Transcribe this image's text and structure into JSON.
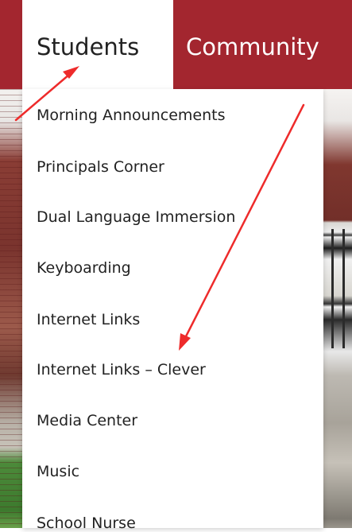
{
  "nav": {
    "students_label": "Students",
    "community_label": "Community",
    "accent_color": "#a3262f"
  },
  "dropdown": {
    "items": [
      {
        "label": "Morning Announcements"
      },
      {
        "label": "Principals Corner"
      },
      {
        "label": "Dual Language Immersion"
      },
      {
        "label": "Keyboarding"
      },
      {
        "label": "Internet Links"
      },
      {
        "label": "Internet Links – Clever"
      },
      {
        "label": "Media Center"
      },
      {
        "label": "Music"
      },
      {
        "label": "School Nurse"
      }
    ]
  },
  "annotation": {
    "arrow_color": "#ee2b2b"
  }
}
